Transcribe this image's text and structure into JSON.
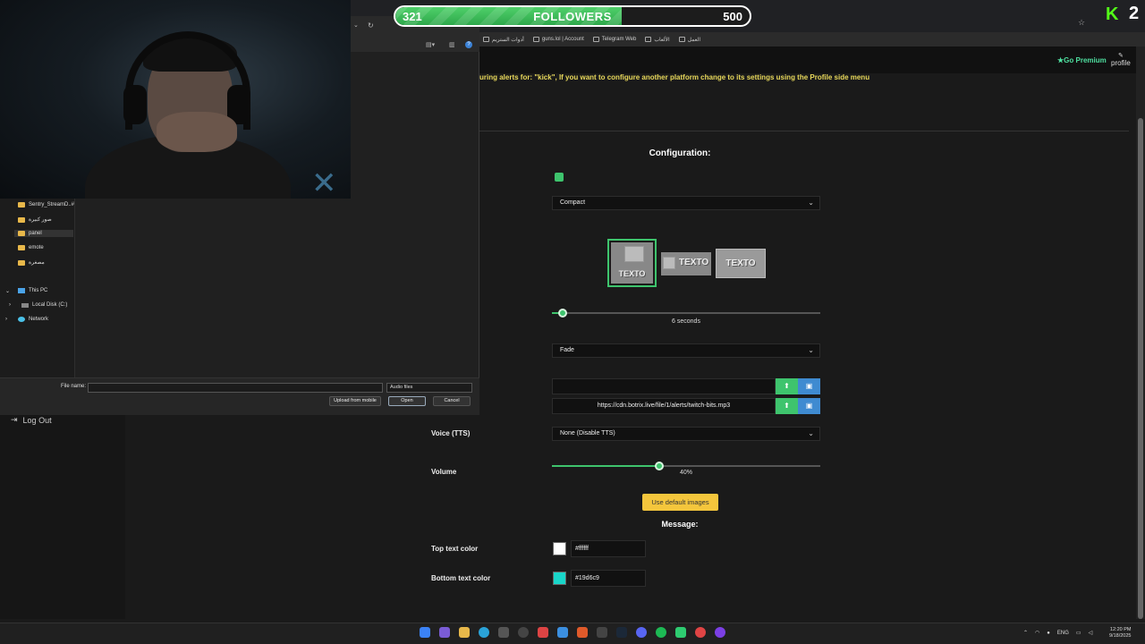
{
  "followers": {
    "current": "321",
    "label": "FOLLOWERS",
    "goal": "500",
    "progress_percent": 64
  },
  "kick": {
    "logo": "K",
    "count": "2"
  },
  "bookmarks": [
    "أدوات الستريم",
    "guns.lol | Account",
    "Telegram Web",
    "الألعاب",
    "العمل"
  ],
  "dialog": {
    "nav": [
      {
        "label": "Sentry_StreamD..#",
        "type": "folder"
      },
      {
        "label": "صور كبيرة",
        "type": "folder"
      },
      {
        "label": "panel",
        "type": "folder"
      },
      {
        "label": "emote",
        "type": "folder"
      },
      {
        "label": "مصغرة",
        "type": "folder"
      },
      {
        "label": "This PC",
        "type": "pc"
      },
      {
        "label": "Local Disk (C:)",
        "type": "disk"
      },
      {
        "label": "Network",
        "type": "network"
      }
    ],
    "file_name_label": "File name:",
    "file_name_value": "",
    "file_type": "Audio files",
    "upload_mobile": "Upload from mobile",
    "open": "Open",
    "cancel": "Cancel"
  },
  "header": {
    "premium": "Go Premium",
    "profile": "profile"
  },
  "warning": "uring alerts for: \"kick\", If you want to configure another platform change to its settings using the Profile side menu",
  "sidebar": {
    "logout": "Log Out"
  },
  "config": {
    "title": "Configuration:",
    "style_select": "Compact",
    "layout_text": "TEXTO",
    "duration_label": "6 seconds",
    "duration_fraction": 0.04,
    "animation_select": "Fade",
    "image_url": "",
    "sound_url": "https://cdn.botrix.live/file/1/alerts/twitch-bits.mp3",
    "voice_label": "Voice (TTS)",
    "voice_select": "None (Disable TTS)",
    "volume_label": "Volume",
    "volume_value": "40%",
    "volume_fraction": 0.4,
    "default_images": "Use default images",
    "message_title": "Message:",
    "top_color_label": "Top text color",
    "top_color": "#ffffff",
    "bottom_color_label": "Bottom text color",
    "bottom_color": "#19d6c9"
  },
  "taskbar": {
    "lang": "ENG",
    "time": "12:20 PM",
    "date": "9/18/2025"
  },
  "colors": {
    "accent": "#3ec46d",
    "premium": "#4fe0a0",
    "warning": "#e8d85a",
    "default_btn": "#f4c63c"
  }
}
